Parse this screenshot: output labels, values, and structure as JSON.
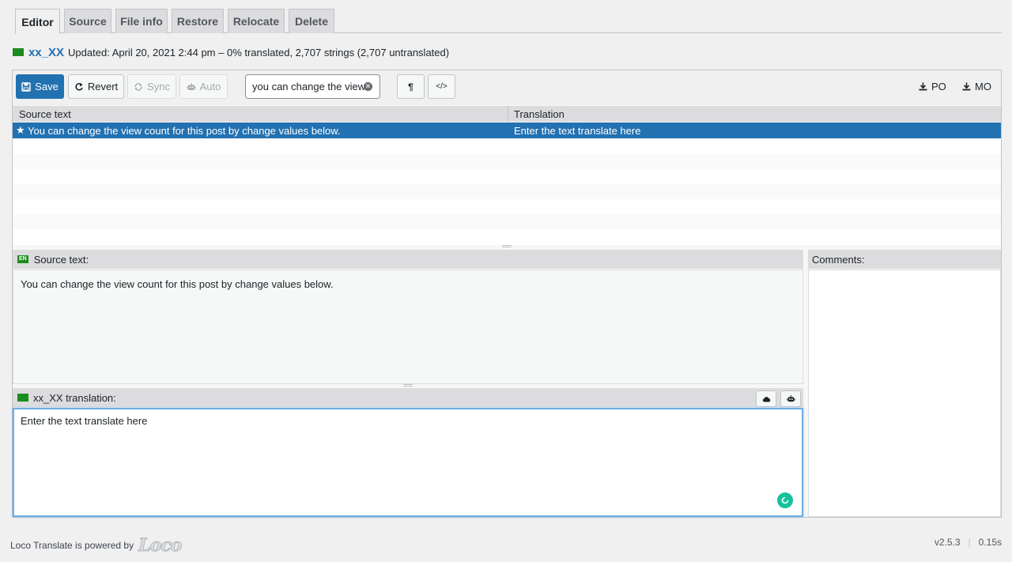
{
  "tabs": [
    "Editor",
    "Source",
    "File info",
    "Restore",
    "Relocate",
    "Delete"
  ],
  "header": {
    "locale": "xx_XX",
    "status": "Updated: April 20, 2021 2:44 pm – 0% translated, 2,707 strings (2,707 untranslated)"
  },
  "toolbar": {
    "save_label": "Save",
    "revert_label": "Revert",
    "sync_label": "Sync",
    "auto_label": "Auto",
    "search_value": "you can change the view",
    "pilcrow": "¶",
    "code_toggle": "</>",
    "po_label": "PO",
    "mo_label": "MO"
  },
  "grid": {
    "columns": [
      "Source text",
      "Translation"
    ],
    "rows": [
      {
        "source": "You can change the view count for this post by change values below.",
        "translation": "Enter the text translate here",
        "starred": true
      }
    ]
  },
  "source_panel": {
    "lang_badge": "EN",
    "title": "Source text:",
    "text": "You can change the view count for this post by change values below."
  },
  "comments_panel": {
    "title": "Comments:"
  },
  "translation_panel": {
    "title": "xx_XX translation:",
    "text": "Enter the text translate here"
  },
  "footer": {
    "powered_text": "Loco Translate is powered by",
    "logo_text": "Loco",
    "version": "v2.5.3",
    "timing": "0.15s"
  },
  "colors": {
    "primary": "#2271b1",
    "flag_green": "#1c8c1c",
    "grammarly": "#15c39a"
  }
}
